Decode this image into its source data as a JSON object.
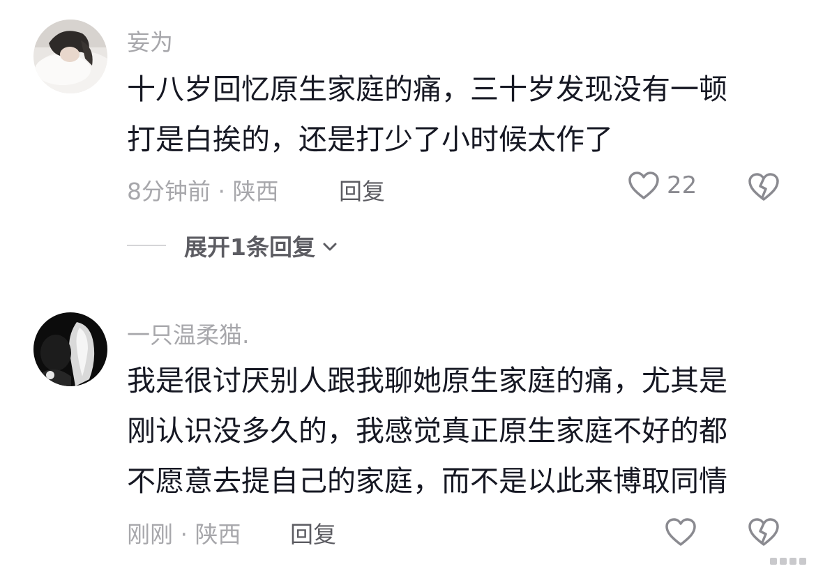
{
  "comments": [
    {
      "username": "妄为",
      "text_lines": [
        "十八岁回忆原生家庭的痛，三十岁发现没有一顿",
        "打是白挨的，还是打少了小时候太作了"
      ],
      "time": "8分钟前",
      "location": "陕西",
      "meta": "8分钟前 · 陕西",
      "reply_label": "回复",
      "like_count": "22",
      "expand_label": "展开1条回复"
    },
    {
      "username": "一只温柔猫.",
      "text_lines": [
        "我是很讨厌别人跟我聊她原生家庭的痛，尤其是",
        "刚认识没多久的，我感觉真正原生家庭不好的都",
        "不愿意去提自己的家庭，而不是以此来博取同情"
      ],
      "time": "刚刚",
      "location": "陕西",
      "meta": "刚刚 · 陕西",
      "reply_label": "回复"
    }
  ],
  "icons": {
    "like": "heart-outline-icon",
    "dislike": "broken-heart-icon",
    "expand": "chevron-down-icon"
  },
  "colors": {
    "text": "#161823",
    "muted": "#a7a7ab",
    "action": "#5c5c62",
    "icon": "#8a8a90"
  }
}
